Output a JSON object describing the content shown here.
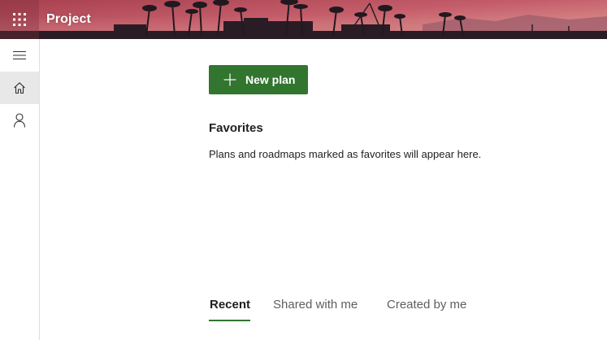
{
  "header": {
    "app_title": "Project",
    "app_launcher_icon": "waffle-icon",
    "banner_colors": [
      "#b34d5d",
      "#d88a86",
      "#2a1c24"
    ]
  },
  "rail": {
    "items": [
      {
        "icon": "hamburger-icon",
        "active": false
      },
      {
        "icon": "home-icon",
        "active": true
      },
      {
        "icon": "person-icon",
        "active": false
      }
    ]
  },
  "main": {
    "new_plan_label": "New plan",
    "favorites_title": "Favorites",
    "favorites_empty_text": "Plans and roadmaps marked as favorites will appear here.",
    "tabs": [
      {
        "label": "Recent",
        "selected": true
      },
      {
        "label": "Shared with me",
        "selected": false
      },
      {
        "label": "Created by me",
        "selected": false
      }
    ]
  },
  "colors": {
    "accent": "#31752f",
    "rail_active_bg": "#e8e8e8",
    "text_primary": "#201f1e",
    "text_secondary": "#605e5c"
  }
}
